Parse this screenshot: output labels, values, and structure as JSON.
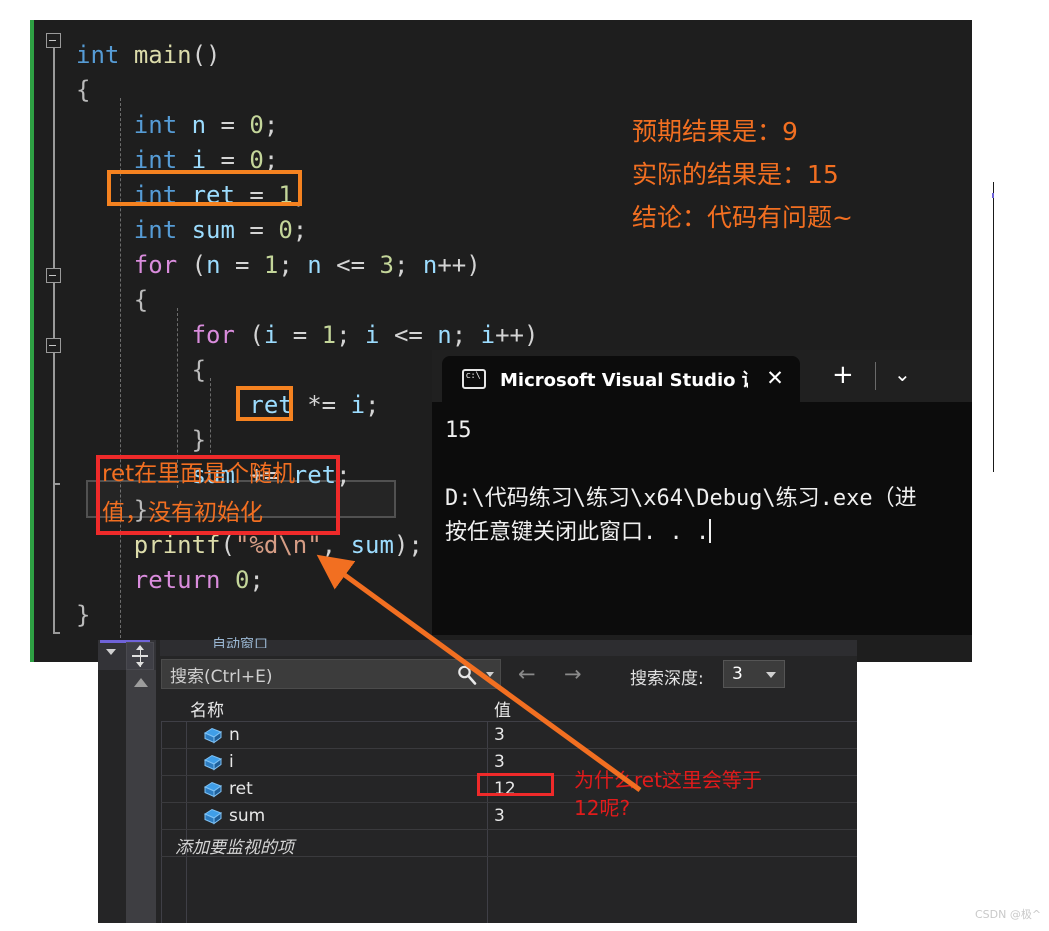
{
  "editor": {
    "lines": [
      "int main()",
      "{",
      "    int n = 0;",
      "    int i = 0;",
      "    int ret = 1;",
      "    int sum = 0;",
      "    for (n = 1; n <= 3; n++)",
      "    {",
      "        for (i = 1; i <= n; i++)",
      "        {",
      "            ret *= i;",
      "        }",
      "        sum += ret;",
      "    }",
      "    printf(\"%d\\n\", sum);",
      "    return 0;",
      "}"
    ],
    "highlighted_lines": [
      "int ret = 1;",
      "ret"
    ],
    "current_line": "sum += ret;"
  },
  "annotations": {
    "orange_right": [
      "预期结果是：9",
      "实际的结果是：15",
      "结论：代码有问题~"
    ],
    "red_box_note": "ret在里面是个随机\n值，没有初始化",
    "red_watch_note": "为什么ret这里会等于\n12呢?"
  },
  "terminal": {
    "tab_title": "Microsoft Visual Studio 调试挖",
    "tab_icon": "console-icon",
    "close_label": "✕",
    "new_tab_label": "+",
    "dropdown_label": "⌄",
    "output_value": "15",
    "output_path": "D:\\代码练习\\练习\\x64\\Debug\\练习.exe（进",
    "output_prompt": "按任意键关闭此窗口. . ."
  },
  "watch_panel": {
    "tab_stub_label": "自动窗口",
    "search": {
      "placeholder": "搜索(Ctrl+E)",
      "icon": "search-icon"
    },
    "nav_back": "←",
    "nav_forward": "→",
    "depth_label": "搜索深度:",
    "depth_value": "3",
    "columns": [
      "名称",
      "值"
    ],
    "rows": [
      {
        "name": "n",
        "value": "3"
      },
      {
        "name": "i",
        "value": "3"
      },
      {
        "name": "ret",
        "value": "12"
      },
      {
        "name": "sum",
        "value": "3"
      }
    ],
    "add_watch_label": "添加要监视的项",
    "highlighted_value": "12"
  },
  "watermark": "CSDN @极^",
  "colors": {
    "accent_orange": "#f26f21",
    "box_orange": "#f58220",
    "annotation_red": "#ef2a2a",
    "editor_bg": "#1e1e1e",
    "terminal_bg": "#0c0c0c",
    "panel_bg": "#252526",
    "changebar_green": "#2ea043"
  }
}
